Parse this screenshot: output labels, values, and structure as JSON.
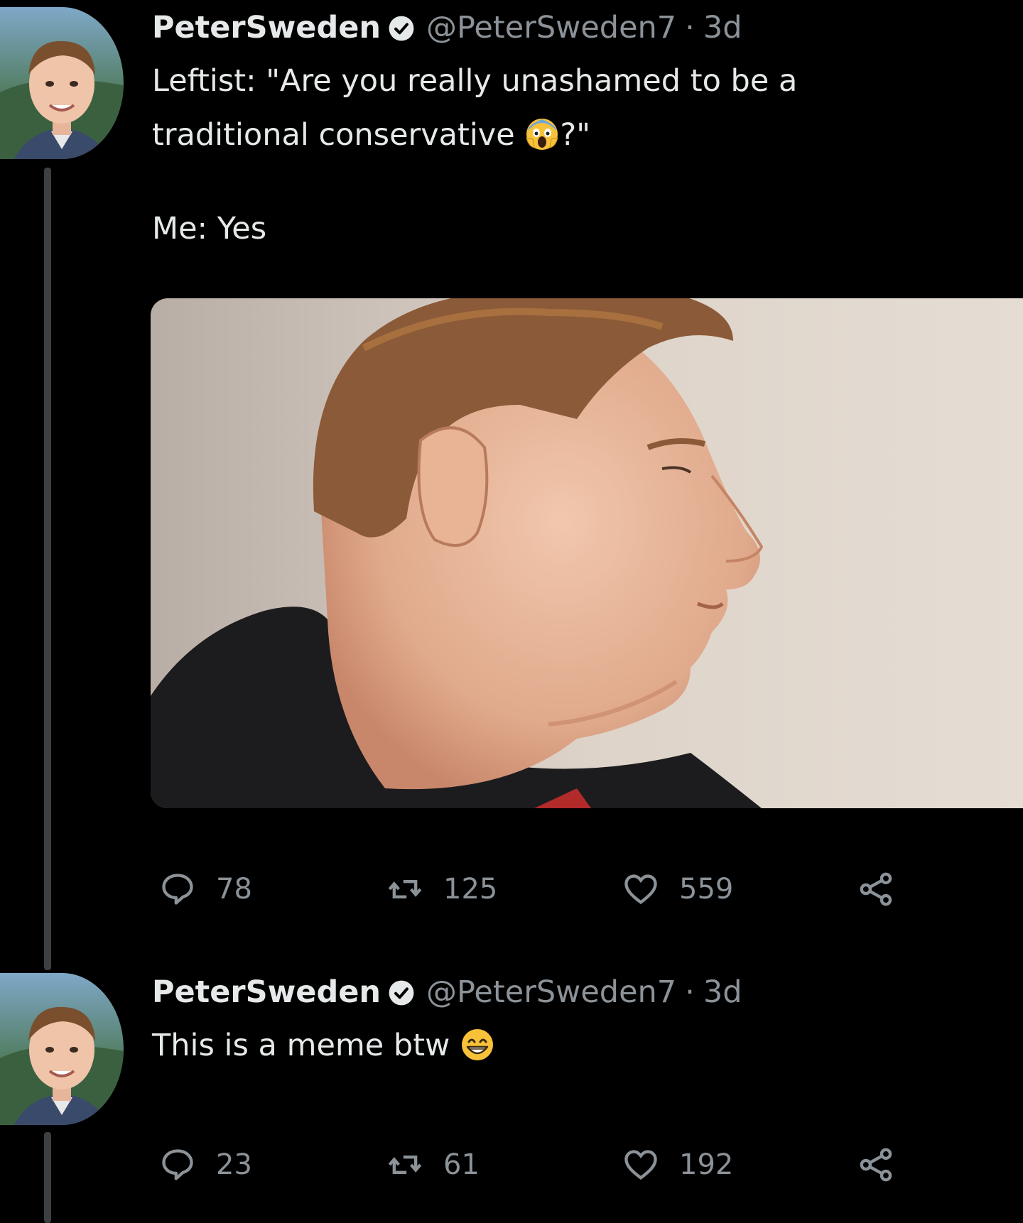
{
  "tweets": [
    {
      "display_name": "PeterSweden",
      "handle": "@PeterSweden7",
      "separator": "·",
      "time": "3d",
      "text_lines": [
        "Leftist: \"Are you really unashamed to be a",
        "traditional conservative",
        "?\"",
        "Me: Yes"
      ],
      "emoji": "face-screaming-in-fear",
      "stats": {
        "replies": "78",
        "retweets": "125",
        "likes": "559"
      }
    },
    {
      "display_name": "PeterSweden",
      "handle": "@PeterSweden7",
      "separator": "·",
      "time": "3d",
      "text": "This is a meme btw",
      "emoji": "grinning-face-with-smiling-eyes",
      "stats": {
        "replies": "23",
        "retweets": "61",
        "likes": "192"
      }
    }
  ],
  "icons": {
    "reply": "speech-bubble-icon",
    "retweet": "retweet-icon",
    "like": "heart-icon",
    "share": "share-icon",
    "verified": "verified-badge-icon"
  },
  "colors": {
    "background": "#000000",
    "text": "#e6e9ea",
    "muted": "#8b9298",
    "thread_line": "#3d4043"
  }
}
